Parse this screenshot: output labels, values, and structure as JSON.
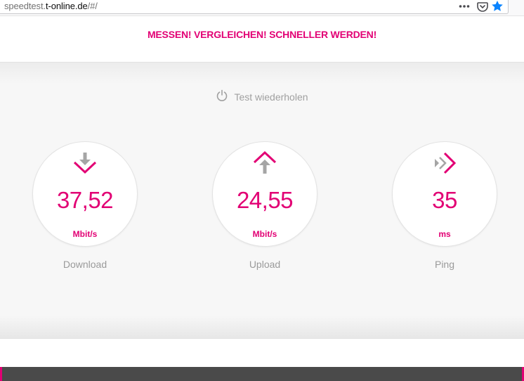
{
  "browser": {
    "url_prefix": "speedtest.",
    "url_host": "t-online.de",
    "url_suffix": "/#/",
    "icons": [
      "more-icon",
      "pocket-icon",
      "bookmark-star-icon"
    ]
  },
  "header": {
    "slogan": "MESSEN! VERGLEICHEN! SCHNELLER WERDEN!"
  },
  "test": {
    "repeat_label": "Test wiederholen",
    "download": {
      "value": "37,52",
      "unit": "Mbit/s",
      "label": "Download"
    },
    "upload": {
      "value": "24,55",
      "unit": "Mbit/s",
      "label": "Upload"
    },
    "ping": {
      "value": "35",
      "unit": "ms",
      "label": "Ping"
    }
  },
  "colors": {
    "brand": "#e20074",
    "muted": "#a0a0a0",
    "icon_gray": "#9b9b9b"
  }
}
